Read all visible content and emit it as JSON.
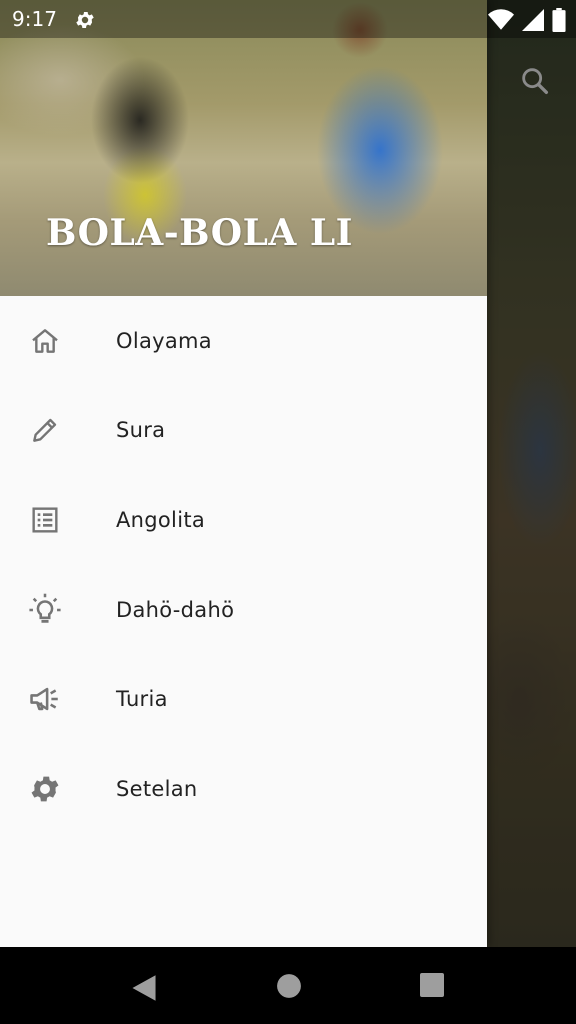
{
  "status_bar": {
    "time": "9:17"
  },
  "drawer": {
    "title": "BOLA-BOLA LI",
    "items": [
      {
        "label": "Olayama",
        "icon": "home-icon"
      },
      {
        "label": "Sura",
        "icon": "pencil-icon"
      },
      {
        "label": "Angolita",
        "icon": "list-icon"
      },
      {
        "label": "Dahö-dahö",
        "icon": "lightbulb-icon"
      },
      {
        "label": "Turia",
        "icon": "megaphone-icon"
      },
      {
        "label": "Setelan",
        "icon": "gear-icon"
      }
    ]
  },
  "colors": {
    "drawer_bg": "#fafafa",
    "icon": "#757575",
    "text": "#222222"
  }
}
